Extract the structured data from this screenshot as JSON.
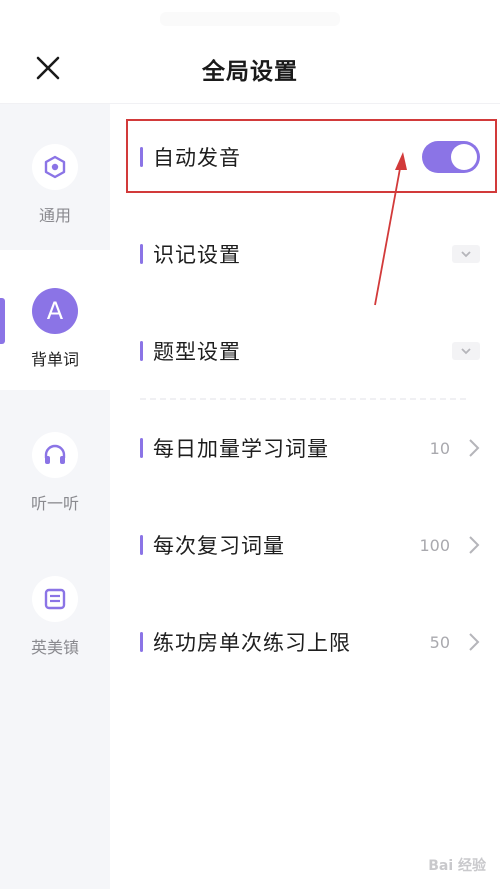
{
  "header": {
    "title": "全局设置",
    "close_icon": "close-icon"
  },
  "sidebar": {
    "items": [
      {
        "label": "通用",
        "icon": "settings-hexagon-icon",
        "active": false
      },
      {
        "label": "背单词",
        "icon": "letter-a-icon",
        "icon_text": "A",
        "active": true
      },
      {
        "label": "听一听",
        "icon": "headphones-icon",
        "active": false
      },
      {
        "label": "英美镇",
        "icon": "book-icon",
        "active": false
      }
    ]
  },
  "settings": {
    "auto_pronounce": {
      "label": "自动发音",
      "toggle_on": true
    },
    "memory": {
      "label": "识记设置"
    },
    "question_type": {
      "label": "题型设置"
    },
    "daily_words": {
      "label": "每日加量学习词量",
      "value": "10"
    },
    "review_words": {
      "label": "每次复习词量",
      "value": "100"
    },
    "practice_limit": {
      "label": "练功房单次练习上限",
      "value": "50"
    }
  },
  "watermark": {
    "text": "Bai 经验"
  },
  "colors": {
    "accent": "#8b74e6",
    "annotation": "#d23a3a",
    "sidebar_bg": "#f5f6f9"
  }
}
